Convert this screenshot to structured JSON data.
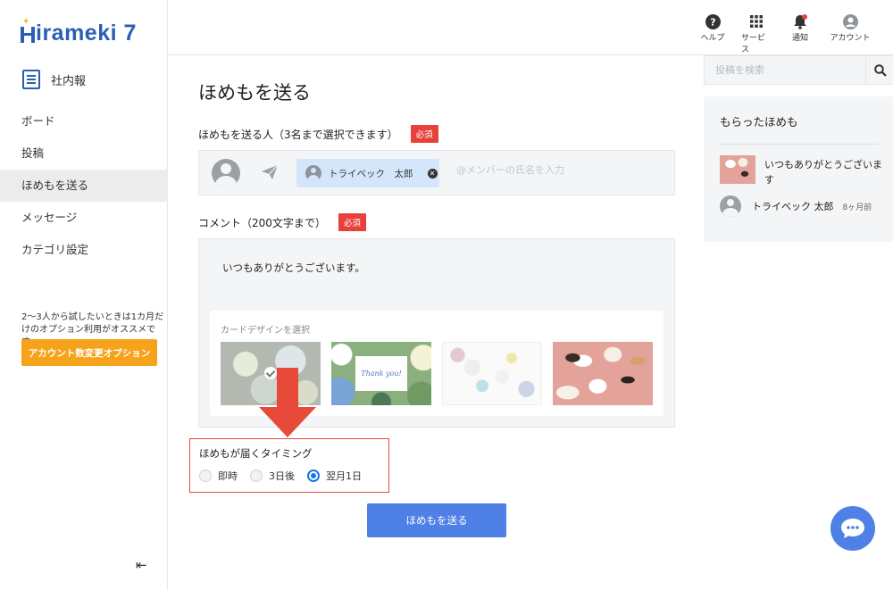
{
  "brand": {
    "logo_text": "irameki 7",
    "app_name": "社内報"
  },
  "sidebar": {
    "items": [
      {
        "label": "ボード"
      },
      {
        "label": "投稿"
      },
      {
        "label": "ほめもを送る"
      },
      {
        "label": "メッセージ"
      },
      {
        "label": "カテゴリ設定"
      }
    ],
    "active_index": 2,
    "promo_text": "2〜3人から試したいときは1カ月だけのオプション利用がオススメです。",
    "promo_button": "アカウント数変更オプション",
    "collapse_icon": "⇤"
  },
  "header": {
    "help": "ヘルプ",
    "services": "サービス",
    "notifications": "通知",
    "account": "アカウント"
  },
  "main": {
    "title": "ほめもを送る",
    "sender_label": "ほめもを送る人（3名まで選択できます）",
    "required": "必須",
    "selected_member": "トライベック　太郎",
    "member_placeholder": "@メンバーの氏名を入力",
    "comment_label": "コメント（200文字まで）",
    "comment_text": "いつもありがとうございます。",
    "card_design_label": "カードデザインを選択",
    "card2_text": "Thank you!",
    "timing_label": "ほめもが届くタイミング",
    "timing_options": [
      "即時",
      "3日後",
      "翌月1日"
    ],
    "timing_selected": 2,
    "submit": "ほめもを送る"
  },
  "right": {
    "search_placeholder": "投稿を検索",
    "received_title": "もらったほめも",
    "received_message": "いつもありがとうございます",
    "received_user": "トライベック 太郎",
    "received_time": "8ヶ月前"
  },
  "colors": {
    "brand": "#2b5fb3",
    "accent": "#4e80e6",
    "required": "#e8413c",
    "promo": "#f7a21b",
    "highlight": "#e34a3f"
  }
}
